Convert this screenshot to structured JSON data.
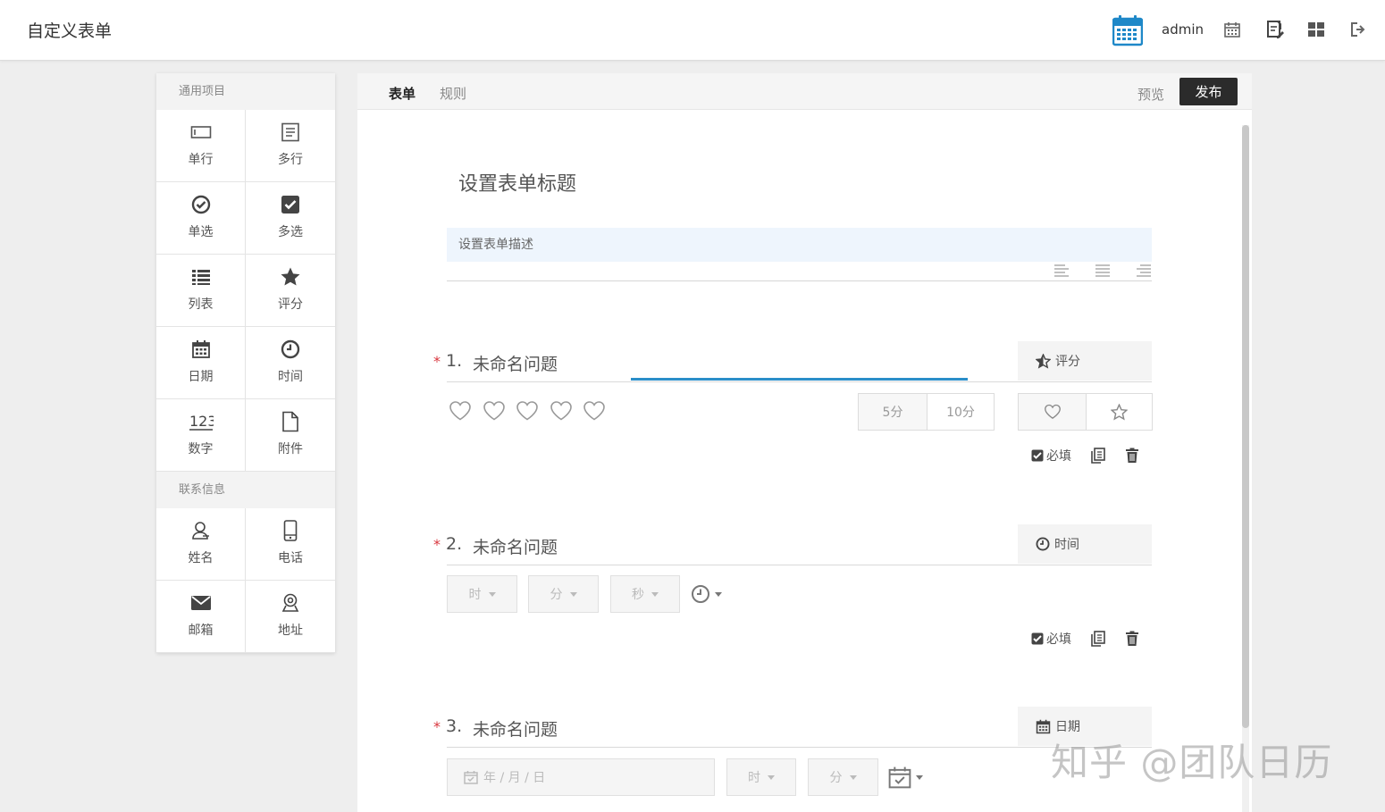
{
  "header": {
    "title": "自定义表单",
    "user": "admin",
    "icons": [
      "calendar-logo-icon",
      "calendar-icon",
      "edit-form-icon",
      "grid-icon",
      "logout-icon"
    ],
    "accent": "#1e88c8"
  },
  "palette": {
    "groups": [
      {
        "label": "通用项目",
        "items": [
          {
            "label": "单行",
            "icon": "single-line-icon"
          },
          {
            "label": "多行",
            "icon": "multi-line-icon"
          },
          {
            "label": "单选",
            "icon": "radio-icon"
          },
          {
            "label": "多选",
            "icon": "checkbox-icon"
          },
          {
            "label": "列表",
            "icon": "list-icon"
          },
          {
            "label": "评分",
            "icon": "star-icon"
          },
          {
            "label": "日期",
            "icon": "calendar-icon"
          },
          {
            "label": "时间",
            "icon": "clock-icon"
          },
          {
            "label": "数字",
            "icon": "number-icon"
          },
          {
            "label": "附件",
            "icon": "file-icon"
          }
        ]
      },
      {
        "label": "联系信息",
        "items": [
          {
            "label": "姓名",
            "icon": "user-icon"
          },
          {
            "label": "电话",
            "icon": "phone-icon"
          },
          {
            "label": "邮箱",
            "icon": "mail-icon"
          },
          {
            "label": "地址",
            "icon": "location-icon"
          }
        ]
      }
    ]
  },
  "tabs": {
    "form": "表单",
    "rules": "规则"
  },
  "actions": {
    "preview": "预览",
    "publish": "发布"
  },
  "form": {
    "title": "设置表单标题",
    "description": "设置表单描述"
  },
  "questions": [
    {
      "required": "*",
      "num": "1.",
      "title": "未命名问题",
      "type": "评分",
      "type_icon": "star-half-icon",
      "rating_count": 5,
      "scale_options": [
        "5分",
        "10分"
      ],
      "shape_options": [
        "heart-icon",
        "star-icon"
      ],
      "required_label": "必填"
    },
    {
      "required": "*",
      "num": "2.",
      "title": "未命名问题",
      "type": "时间",
      "type_icon": "clock-icon",
      "selects": [
        "时",
        "分",
        "秒"
      ],
      "required_label": "必填"
    },
    {
      "required": "*",
      "num": "3.",
      "title": "未命名问题",
      "type": "日期",
      "type_icon": "calendar-icon",
      "date_placeholder": "年 / 月 / 日",
      "selects": [
        "时",
        "分"
      ]
    }
  ],
  "watermark": "知乎 @团队日历"
}
